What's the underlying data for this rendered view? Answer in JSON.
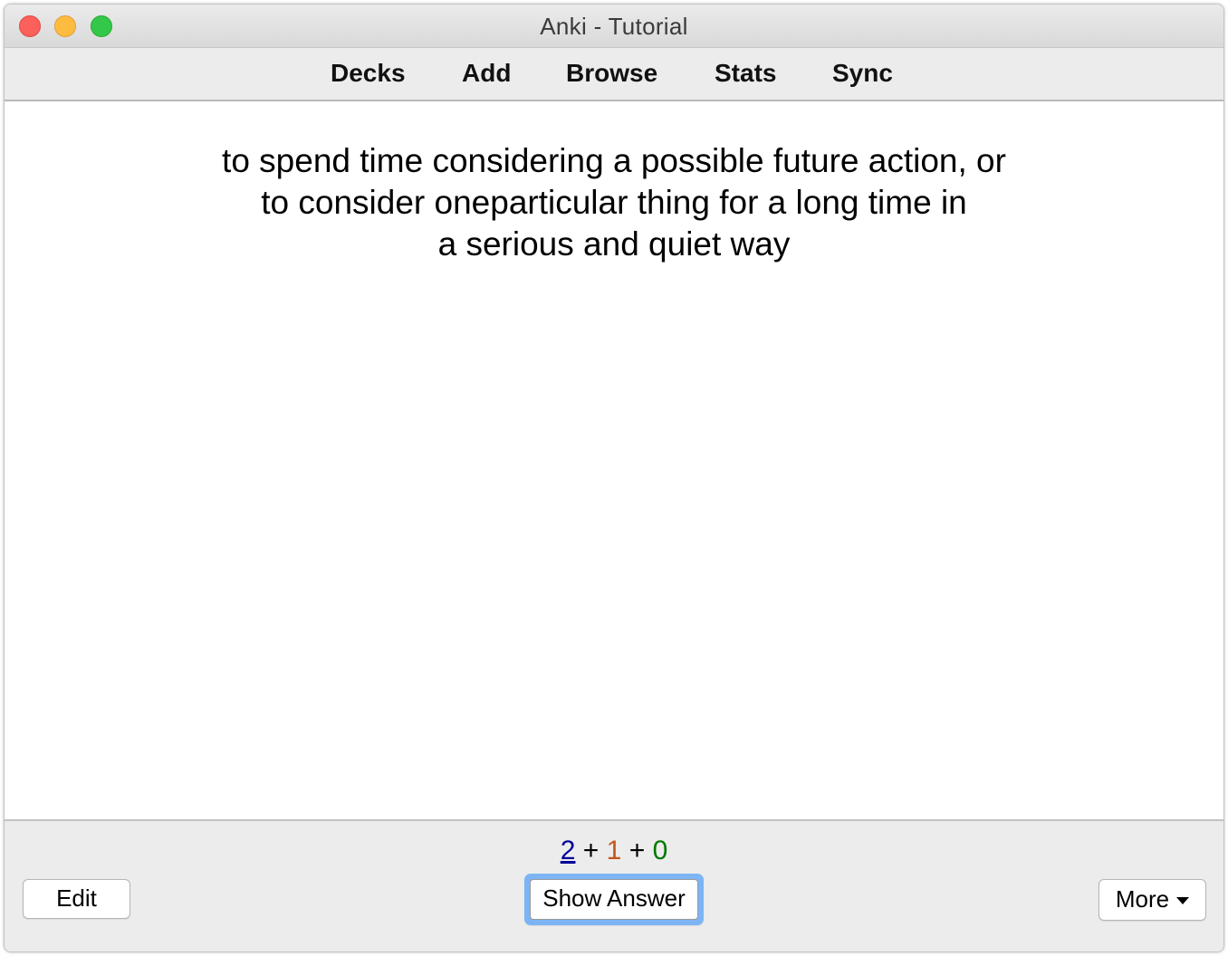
{
  "window": {
    "title": "Anki - Tutorial"
  },
  "toolbar": {
    "items": [
      {
        "label": "Decks"
      },
      {
        "label": "Add"
      },
      {
        "label": "Browse"
      },
      {
        "label": "Stats"
      },
      {
        "label": "Sync"
      }
    ]
  },
  "card": {
    "lines": [
      "to spend time considering a possible future action, or",
      "to consider oneparticular thing for a long time in",
      "a serious and quiet way"
    ]
  },
  "counts": {
    "new": "2",
    "learning": "1",
    "review": "0",
    "separator": "+",
    "colors": {
      "new": "#000099",
      "learning": "#c35617",
      "review": "#007700"
    }
  },
  "bottom": {
    "edit_label": "Edit",
    "show_answer_label": "Show Answer",
    "more_label": "More",
    "more_icon": "chevron-down-icon"
  }
}
